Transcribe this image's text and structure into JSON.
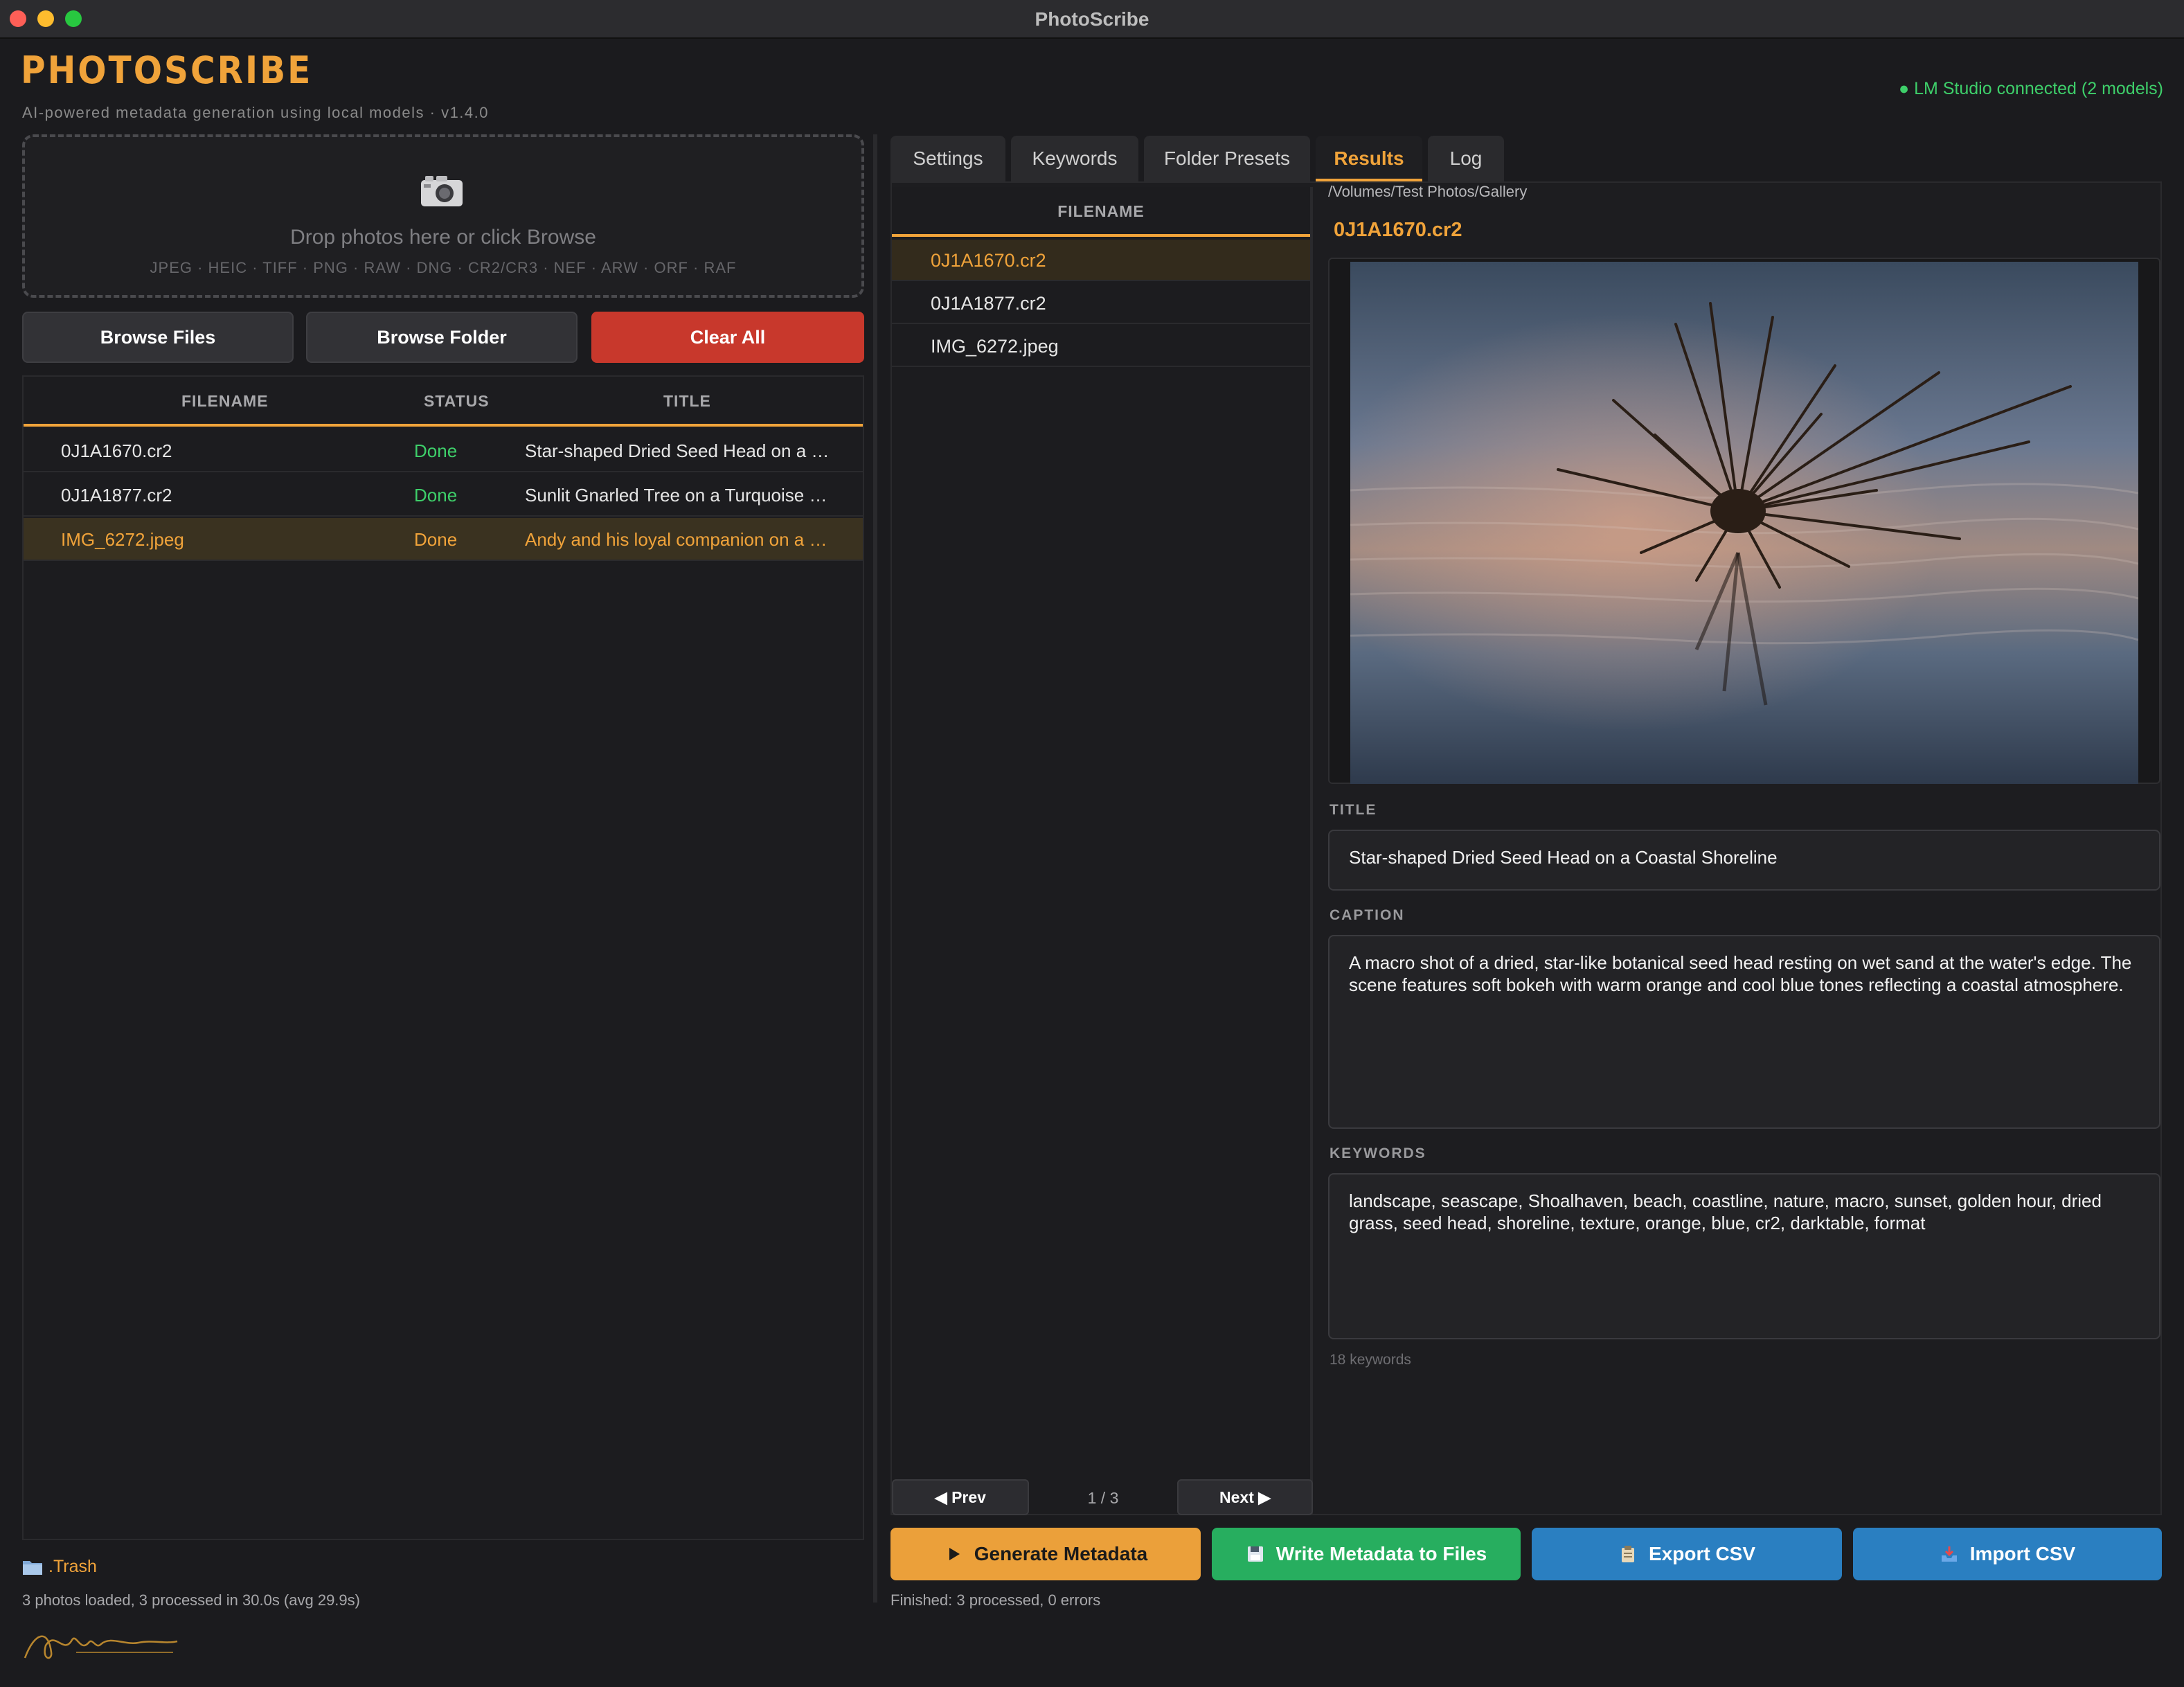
{
  "window": {
    "title": "PhotoScribe"
  },
  "app": {
    "brand": "PHOTOSCRIBE",
    "subtitle": "AI-powered metadata generation using local models  ·  v1.4.0",
    "connection": "● LM Studio connected (2 models)"
  },
  "dropzone": {
    "icon": "camera-icon",
    "text": "Drop photos here or click Browse",
    "formats": "JPEG · HEIC · TIFF · PNG · RAW · DNG · CR2/CR3 · NEF · ARW · ORF · RAF"
  },
  "buttons": {
    "browse_files": "Browse Files",
    "browse_folder": "Browse Folder",
    "clear_all": "Clear All"
  },
  "left_table": {
    "headers": {
      "filename": "FILENAME",
      "status": "STATUS",
      "title": "TITLE"
    },
    "rows": [
      {
        "filename": "0J1A1670.cr2",
        "status": "Done",
        "title": "Star-shaped Dried Seed Head on a …"
      },
      {
        "filename": "0J1A1877.cr2",
        "status": "Done",
        "title": "Sunlit Gnarled Tree on a Turquoise …"
      },
      {
        "filename": "IMG_6272.jpeg",
        "status": "Done",
        "title": "Andy and his loyal companion on a …"
      }
    ]
  },
  "folder": {
    "name": ".Trash"
  },
  "left_status": "3 photos loaded, 3 processed in 30.0s (avg 29.9s)",
  "tabs": [
    "Settings",
    "Keywords",
    "Folder Presets",
    "Results",
    "Log"
  ],
  "results": {
    "list_header": "FILENAME",
    "files": [
      "0J1A1670.cr2",
      "0J1A1877.cr2",
      "IMG_6272.jpeg"
    ],
    "path": "/Volumes/Test Photos/Gallery",
    "selected_file": "0J1A1670.cr2",
    "title_label": "TITLE",
    "title": "Star-shaped Dried Seed Head on a Coastal Shoreline",
    "caption_label": "CAPTION",
    "caption": "A macro shot of a dried, star-like botanical seed head resting on wet sand at the water's edge. The scene features soft bokeh with warm orange and cool blue tones reflecting a coastal atmosphere.",
    "keywords_label": "KEYWORDS",
    "keywords": "landscape, seascape, Shoalhaven, beach, coastline, nature, macro, sunset, golden hour, dried grass, seed head, shoreline, texture, orange, blue, cr2, darktable, format",
    "keyword_count": "18 keywords",
    "pager": {
      "prev": "◀ Prev",
      "page": "1 / 3",
      "next": "Next ▶"
    }
  },
  "actions": {
    "generate": "Generate Metadata",
    "write": "Write Metadata to Files",
    "export": "Export CSV",
    "import": "Import CSV"
  },
  "right_status": "Finished: 3 processed, 0 errors",
  "colors": {
    "accent": "#f0a33a",
    "done": "#3ecf6a",
    "clear": "#c8382c",
    "generate": "#eba03a",
    "write": "#27ae5f",
    "csv": "#2a7fc1"
  }
}
